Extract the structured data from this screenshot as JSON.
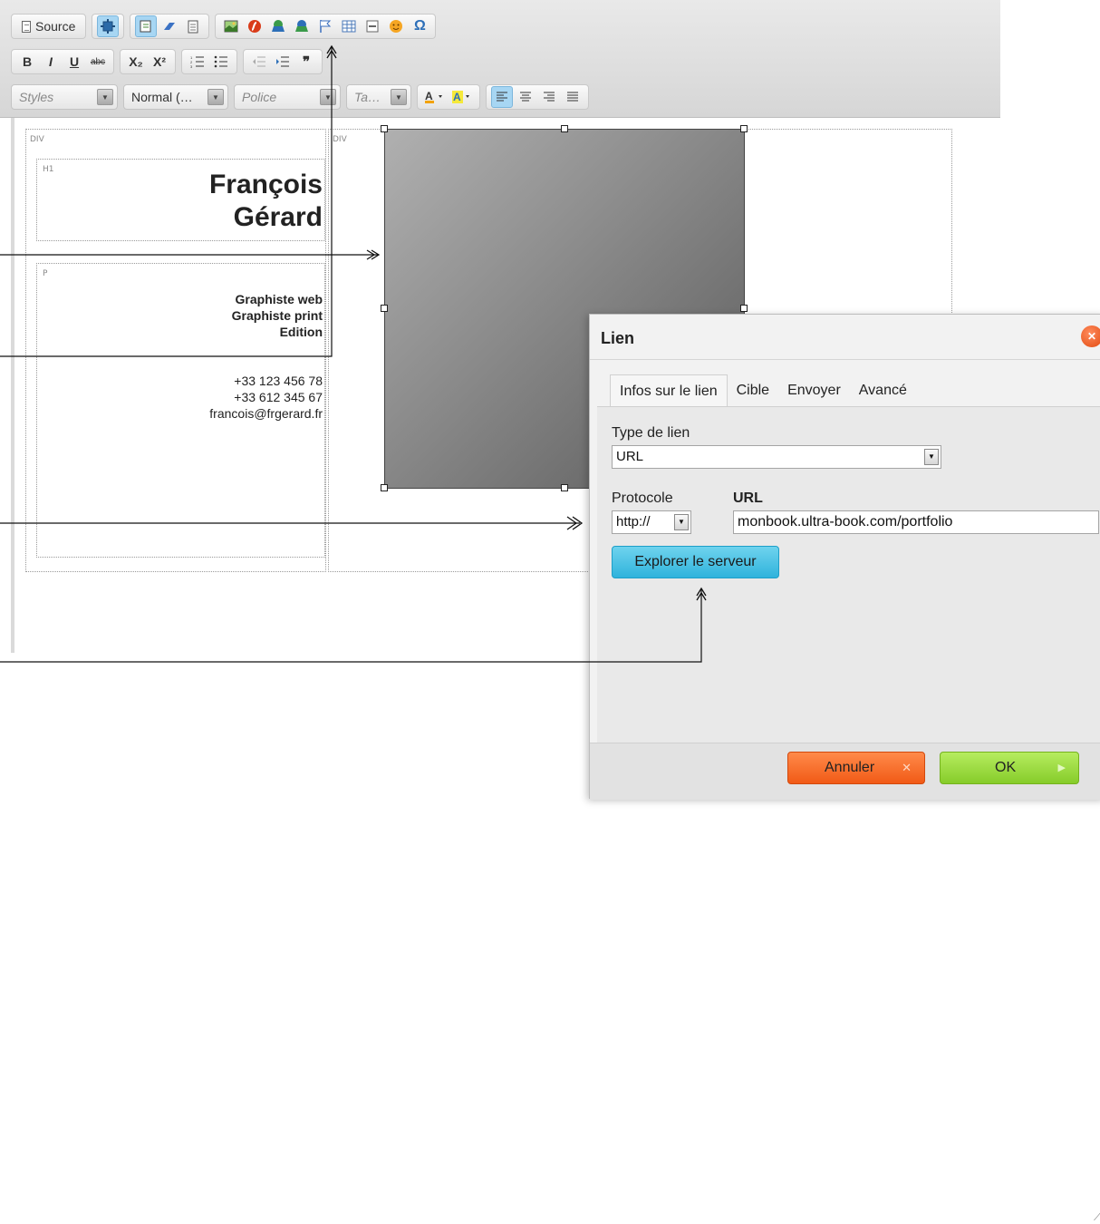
{
  "toolbar": {
    "row1": {
      "source_label": "Source",
      "icons": [
        "maximize-icon",
        "show-blocks-icon",
        "eraser-icon",
        "paste-text-icon",
        "image-icon",
        "flash-icon",
        "link-icon",
        "unlink-icon",
        "anchor-flag-icon",
        "table-icon",
        "horizontal-rule-icon",
        "smiley-icon",
        "omega-icon"
      ],
      "omega": "Ω"
    },
    "row2": {
      "bold": "B",
      "italic": "I",
      "underline": "U",
      "strike": "abc",
      "subscript": "X₂",
      "superscript": "X²",
      "blockquote": "❞"
    },
    "row3": {
      "styles_placeholder": "Styles",
      "format_value": "Normal (…",
      "font_placeholder": "Police",
      "size_placeholder": "Ta…"
    }
  },
  "editor": {
    "div_tag": "DIV",
    "div_tag2": "DIV",
    "h1_tag": "H1",
    "p_tag": "P",
    "name_line1": "François",
    "name_line2": "Gérard",
    "roles": [
      "Graphiste web",
      "Graphiste print",
      "Edition"
    ],
    "phones": [
      "+33 123 456 78",
      "+33 612 345 67"
    ],
    "email": "francois@frgerard.fr"
  },
  "dialog": {
    "title": "Lien",
    "tabs": [
      "Infos sur le lien",
      "Cible",
      "Envoyer",
      "Avancé"
    ],
    "link_type_label": "Type de lien",
    "link_type_value": "URL",
    "protocol_label": "Protocole",
    "protocol_value": "http://",
    "url_label": "URL",
    "url_value": "monbook.ultra-book.com/portfolio",
    "browse_button": "Explorer le serveur",
    "cancel_button": "Annuler",
    "ok_button": "OK"
  },
  "colors": {
    "active_button": "#a7d6f3",
    "browse_button": "#2fb3dc",
    "cancel_button": "#f15a16",
    "ok_button": "#86cc2a",
    "close_icon": "#e24a10"
  }
}
